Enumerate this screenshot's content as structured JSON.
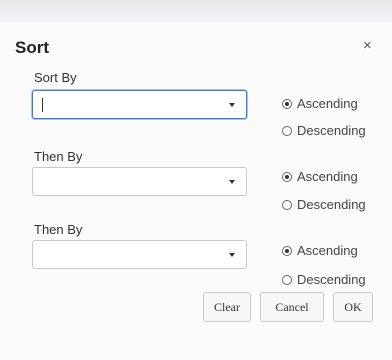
{
  "dialog": {
    "title": "Sort",
    "close_glyph": "×"
  },
  "fields": [
    {
      "label": "Sort By",
      "value": "",
      "order_options": [
        "Ascending",
        "Descending"
      ],
      "selected_order": "Ascending"
    },
    {
      "label": "Then By",
      "value": "",
      "order_options": [
        "Ascending",
        "Descending"
      ],
      "selected_order": "Ascending"
    },
    {
      "label": "Then By",
      "value": "",
      "order_options": [
        "Ascending",
        "Descending"
      ],
      "selected_order": "Ascending"
    }
  ],
  "buttons": {
    "clear": "Clear",
    "cancel": "Cancel",
    "ok": "OK"
  },
  "icons": {
    "close": "close-icon",
    "dropdown": "chevron-down-icon"
  },
  "colors": {
    "focus_border": "#3d7ad0",
    "dialog_bg": "#fbfbfc"
  }
}
